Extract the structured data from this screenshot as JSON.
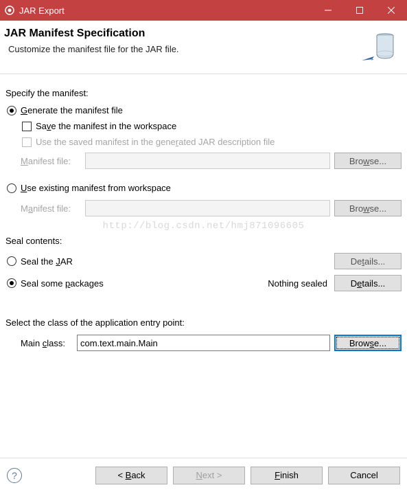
{
  "titlebar": {
    "title": "JAR Export"
  },
  "header": {
    "title": "JAR Manifest Specification",
    "subtitle": "Customize the manifest file for the JAR file."
  },
  "manifest": {
    "section_label": "Specify the manifest:",
    "generate_label": "Generate the manifest file",
    "save_label": "Save the manifest in the workspace",
    "use_saved_label": "Use the saved manifest in the generated JAR description file",
    "manifest_file_label": "Manifest file:",
    "browse_label": "Browse...",
    "use_existing_label": "Use existing manifest from workspace",
    "manifest_file_label2": "Manifest file:",
    "file1_value": "",
    "file2_value": ""
  },
  "watermark": "http://blog.csdn.net/hmj871096605",
  "seal": {
    "section_label": "Seal contents:",
    "seal_jar_label": "Seal the JAR",
    "seal_some_label": "Seal some packages",
    "nothing_sealed": "Nothing sealed",
    "details_label": "Details..."
  },
  "entry": {
    "section_label": "Select the class of the application entry point:",
    "main_class_label": "Main class:",
    "main_class_value": "com.text.main.Main",
    "browse_label": "Browse..."
  },
  "footer": {
    "back_label": "< Back",
    "next_label": "Next >",
    "finish_label": "Finish",
    "cancel_label": "Cancel"
  }
}
